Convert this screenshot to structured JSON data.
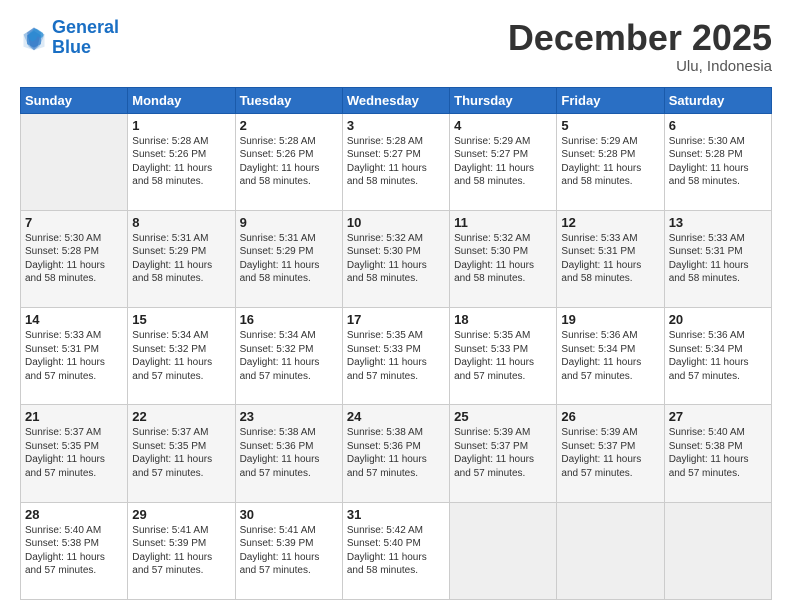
{
  "header": {
    "logo_line1": "General",
    "logo_line2": "Blue",
    "month": "December 2025",
    "location": "Ulu, Indonesia"
  },
  "days_of_week": [
    "Sunday",
    "Monday",
    "Tuesday",
    "Wednesday",
    "Thursday",
    "Friday",
    "Saturday"
  ],
  "weeks": [
    [
      {
        "day": "",
        "info": ""
      },
      {
        "day": "1",
        "info": "Sunrise: 5:28 AM\nSunset: 5:26 PM\nDaylight: 11 hours\nand 58 minutes."
      },
      {
        "day": "2",
        "info": "Sunrise: 5:28 AM\nSunset: 5:26 PM\nDaylight: 11 hours\nand 58 minutes."
      },
      {
        "day": "3",
        "info": "Sunrise: 5:28 AM\nSunset: 5:27 PM\nDaylight: 11 hours\nand 58 minutes."
      },
      {
        "day": "4",
        "info": "Sunrise: 5:29 AM\nSunset: 5:27 PM\nDaylight: 11 hours\nand 58 minutes."
      },
      {
        "day": "5",
        "info": "Sunrise: 5:29 AM\nSunset: 5:28 PM\nDaylight: 11 hours\nand 58 minutes."
      },
      {
        "day": "6",
        "info": "Sunrise: 5:30 AM\nSunset: 5:28 PM\nDaylight: 11 hours\nand 58 minutes."
      }
    ],
    [
      {
        "day": "7",
        "info": "Sunrise: 5:30 AM\nSunset: 5:28 PM\nDaylight: 11 hours\nand 58 minutes."
      },
      {
        "day": "8",
        "info": "Sunrise: 5:31 AM\nSunset: 5:29 PM\nDaylight: 11 hours\nand 58 minutes."
      },
      {
        "day": "9",
        "info": "Sunrise: 5:31 AM\nSunset: 5:29 PM\nDaylight: 11 hours\nand 58 minutes."
      },
      {
        "day": "10",
        "info": "Sunrise: 5:32 AM\nSunset: 5:30 PM\nDaylight: 11 hours\nand 58 minutes."
      },
      {
        "day": "11",
        "info": "Sunrise: 5:32 AM\nSunset: 5:30 PM\nDaylight: 11 hours\nand 58 minutes."
      },
      {
        "day": "12",
        "info": "Sunrise: 5:33 AM\nSunset: 5:31 PM\nDaylight: 11 hours\nand 58 minutes."
      },
      {
        "day": "13",
        "info": "Sunrise: 5:33 AM\nSunset: 5:31 PM\nDaylight: 11 hours\nand 58 minutes."
      }
    ],
    [
      {
        "day": "14",
        "info": "Sunrise: 5:33 AM\nSunset: 5:31 PM\nDaylight: 11 hours\nand 57 minutes."
      },
      {
        "day": "15",
        "info": "Sunrise: 5:34 AM\nSunset: 5:32 PM\nDaylight: 11 hours\nand 57 minutes."
      },
      {
        "day": "16",
        "info": "Sunrise: 5:34 AM\nSunset: 5:32 PM\nDaylight: 11 hours\nand 57 minutes."
      },
      {
        "day": "17",
        "info": "Sunrise: 5:35 AM\nSunset: 5:33 PM\nDaylight: 11 hours\nand 57 minutes."
      },
      {
        "day": "18",
        "info": "Sunrise: 5:35 AM\nSunset: 5:33 PM\nDaylight: 11 hours\nand 57 minutes."
      },
      {
        "day": "19",
        "info": "Sunrise: 5:36 AM\nSunset: 5:34 PM\nDaylight: 11 hours\nand 57 minutes."
      },
      {
        "day": "20",
        "info": "Sunrise: 5:36 AM\nSunset: 5:34 PM\nDaylight: 11 hours\nand 57 minutes."
      }
    ],
    [
      {
        "day": "21",
        "info": "Sunrise: 5:37 AM\nSunset: 5:35 PM\nDaylight: 11 hours\nand 57 minutes."
      },
      {
        "day": "22",
        "info": "Sunrise: 5:37 AM\nSunset: 5:35 PM\nDaylight: 11 hours\nand 57 minutes."
      },
      {
        "day": "23",
        "info": "Sunrise: 5:38 AM\nSunset: 5:36 PM\nDaylight: 11 hours\nand 57 minutes."
      },
      {
        "day": "24",
        "info": "Sunrise: 5:38 AM\nSunset: 5:36 PM\nDaylight: 11 hours\nand 57 minutes."
      },
      {
        "day": "25",
        "info": "Sunrise: 5:39 AM\nSunset: 5:37 PM\nDaylight: 11 hours\nand 57 minutes."
      },
      {
        "day": "26",
        "info": "Sunrise: 5:39 AM\nSunset: 5:37 PM\nDaylight: 11 hours\nand 57 minutes."
      },
      {
        "day": "27",
        "info": "Sunrise: 5:40 AM\nSunset: 5:38 PM\nDaylight: 11 hours\nand 57 minutes."
      }
    ],
    [
      {
        "day": "28",
        "info": "Sunrise: 5:40 AM\nSunset: 5:38 PM\nDaylight: 11 hours\nand 57 minutes."
      },
      {
        "day": "29",
        "info": "Sunrise: 5:41 AM\nSunset: 5:39 PM\nDaylight: 11 hours\nand 57 minutes."
      },
      {
        "day": "30",
        "info": "Sunrise: 5:41 AM\nSunset: 5:39 PM\nDaylight: 11 hours\nand 57 minutes."
      },
      {
        "day": "31",
        "info": "Sunrise: 5:42 AM\nSunset: 5:40 PM\nDaylight: 11 hours\nand 58 minutes."
      },
      {
        "day": "",
        "info": ""
      },
      {
        "day": "",
        "info": ""
      },
      {
        "day": "",
        "info": ""
      }
    ]
  ]
}
